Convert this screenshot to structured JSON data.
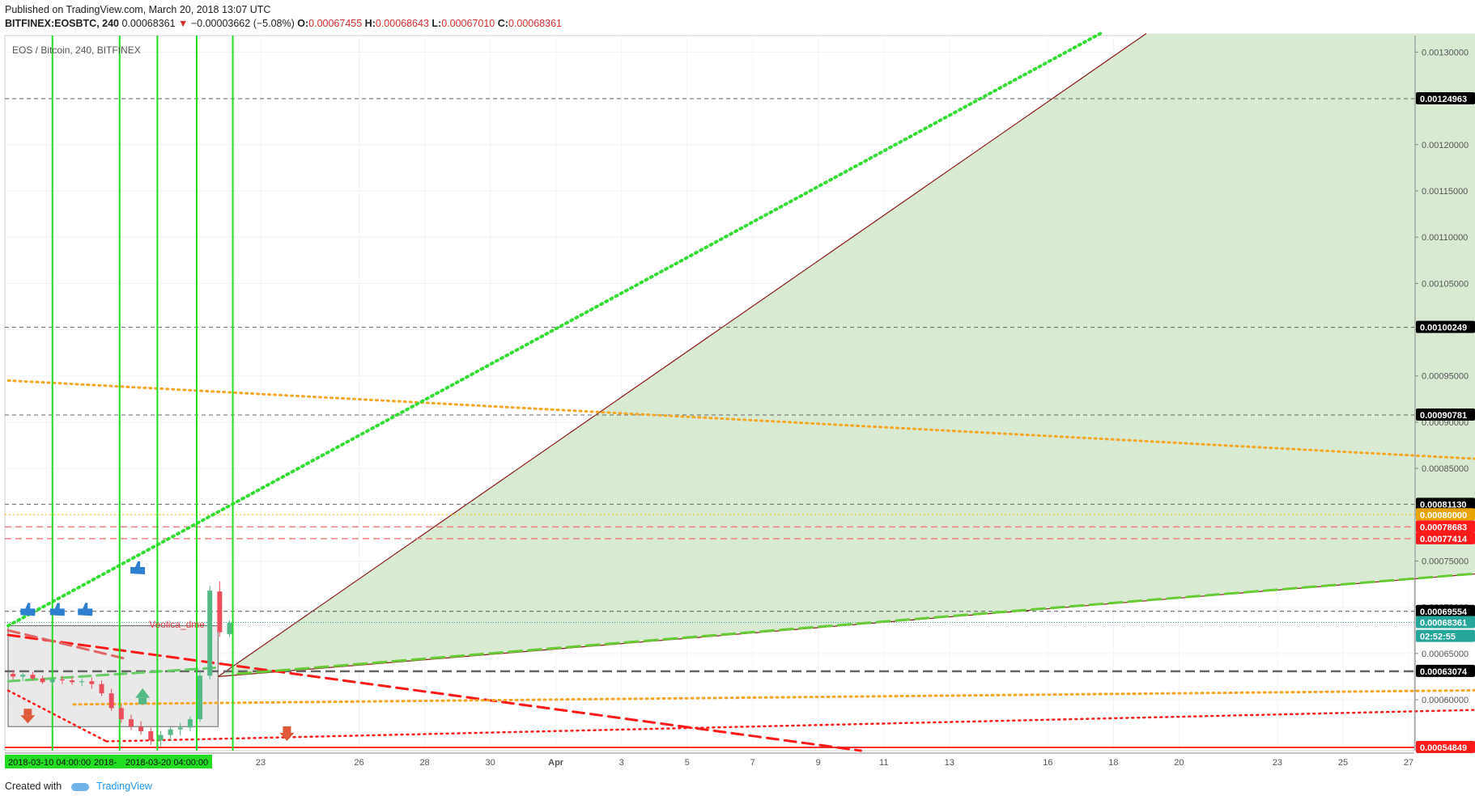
{
  "header": {
    "published": "Published on TradingView.com, March 20, 2018 13:07 UTC",
    "symbol": "BITFINEX:EOSBTC, 240",
    "last": "0.00068361",
    "change": "−0.00003662 (−5.08%)",
    "ohlc": {
      "o_label": "O:",
      "o": "0.00067455",
      "h_label": "H:",
      "h": "0.00068643",
      "l_label": "L:",
      "l": "0.00067010",
      "c_label": "C:",
      "c": "0.00068361"
    }
  },
  "footer": {
    "created_with": "Created with",
    "brand": "TradingView"
  },
  "chart_data": {
    "type": "candlestick",
    "title": "EOS / Bitcoin, 240, BITFINEX",
    "ylim": [
      0.000545,
      0.0013178
    ],
    "y_ticks": [
      "0.00130000",
      "0.00125000",
      "0.00120000",
      "0.00115000",
      "0.00110000",
      "0.00105000",
      "0.00100000",
      "0.00095000",
      "0.00090000",
      "0.00085000",
      "0.00080000",
      "0.00075000",
      "0.00070000",
      "0.00065000",
      "0.00060000",
      "0.00055000"
    ],
    "x_ticks": [
      {
        "label": "23",
        "day": 23
      },
      {
        "label": "26",
        "day": 26
      },
      {
        "label": "28",
        "day": 28
      },
      {
        "label": "30",
        "day": 30
      },
      {
        "label": "Apr",
        "day": 32
      },
      {
        "label": "3",
        "day": 34
      },
      {
        "label": "5",
        "day": 36
      },
      {
        "label": "7",
        "day": 38
      },
      {
        "label": "9",
        "day": 40
      },
      {
        "label": "11",
        "day": 42
      },
      {
        "label": "13",
        "day": 44
      },
      {
        "label": "16",
        "day": 47
      },
      {
        "label": "18",
        "day": 49
      },
      {
        "label": "20",
        "day": 51
      },
      {
        "label": "23",
        "day": 54
      },
      {
        "label": "25",
        "day": 56
      },
      {
        "label": "27",
        "day": 58
      }
    ],
    "x_axis_highlight": [
      "2018-03-10 04:00:00",
      "2018-",
      "2018-03-20 04:00:00"
    ],
    "price_labels": [
      {
        "value": "0.00124963",
        "y": 0.00124963,
        "bg": "#000000"
      },
      {
        "value": "0.00100249",
        "y": 0.00100249,
        "bg": "#000000"
      },
      {
        "value": "0.00090781",
        "y": 0.00090781,
        "bg": "#000000"
      },
      {
        "value": "0.00081130",
        "y": 0.0008113,
        "bg": "#000000"
      },
      {
        "value": "0.00080000",
        "y": 0.0008,
        "bg": "#e8a400"
      },
      {
        "value": "0.00078683",
        "y": 0.00078683,
        "bg": "#ff1a1a"
      },
      {
        "value": "0.00077414",
        "y": 0.00077414,
        "bg": "#ff1a1a"
      },
      {
        "value": "0.00069554",
        "y": 0.00069554,
        "bg": "#000000"
      },
      {
        "value": "0.00068361",
        "y": 0.00068361,
        "bg": "#26a69a"
      },
      {
        "value": "02:52:55",
        "y": 0.00066861,
        "bg": "#26a69a"
      },
      {
        "value": "0.00063074",
        "y": 0.00063074,
        "bg": "#000000"
      },
      {
        "value": "0.00054849",
        "y": 0.00054849,
        "bg": "#ff1a1a"
      }
    ],
    "horizontal_lines": [
      {
        "y": 0.00124963,
        "color": "#666666",
        "dash": "5,4",
        "width": 1
      },
      {
        "y": 0.00100249,
        "color": "#666666",
        "dash": "5,4",
        "width": 1
      },
      {
        "y": 0.00090781,
        "color": "#666666",
        "dash": "5,4",
        "width": 1
      },
      {
        "y": 0.0008113,
        "color": "#666666",
        "dash": "5,4",
        "width": 1
      },
      {
        "y": 0.0008,
        "color": "#f5c000",
        "dash": "2,3",
        "width": 1
      },
      {
        "y": 0.00078683,
        "color": "#f08080",
        "dash": "8,5",
        "width": 1.5
      },
      {
        "y": 0.00077414,
        "color": "#f08080",
        "dash": "8,5",
        "width": 1.5
      },
      {
        "y": 0.00069554,
        "color": "#555555",
        "dash": "5,4",
        "width": 1
      },
      {
        "y": 0.00068361,
        "color": "#26a69a",
        "dash": "1,2",
        "width": 1
      },
      {
        "y": 0.00063074,
        "color": "#666666",
        "dash": "12,6",
        "width": 2.5
      },
      {
        "y": 0.00054849,
        "color": "#ff3030",
        "dash": "",
        "width": 2
      }
    ],
    "trend_lines": [
      {
        "x1": 0,
        "y1": 0.00067,
        "x2": 26,
        "y2": 0.000545,
        "color": "#ff1a1a",
        "dash": "14,8",
        "width": 3
      },
      {
        "x1": 0,
        "y1": 0.000675,
        "x2": 3.5,
        "y2": 0.000645,
        "color": "#e06666",
        "dash": "14,8",
        "width": 3
      },
      {
        "x1": 0,
        "y1": 0.00062,
        "x2": 6.5,
        "y2": 0.000635,
        "color": "#66cc66",
        "dash": "14,8",
        "width": 3
      },
      {
        "x1": 2,
        "y1": 0.000595,
        "x2": 58.2,
        "y2": 0.000615,
        "color": "#f5a623",
        "dash": "2,5",
        "width": 3
      },
      {
        "x1": 0,
        "y1": 0.00061,
        "x2": 3,
        "y2": 0.000555,
        "color": "#ff1a1a",
        "dash": "2,5",
        "width": 2.5
      },
      {
        "x1": 3,
        "y1": 0.000555,
        "x2": 58.2,
        "y2": 0.0006,
        "color": "#ff1a1a",
        "dash": "2,5",
        "width": 2.5
      },
      {
        "x1": 0,
        "y1": 0.000945,
        "x2": 58.2,
        "y2": 0.000835,
        "color": "#f5a623",
        "dash": "2,5",
        "width": 3
      },
      {
        "x1": 0,
        "y1": 0.00068,
        "x2": 33.3,
        "y2": 0.00132,
        "color": "#33dd33",
        "dash": "2,5",
        "width": 4
      },
      {
        "x1": 7,
        "y1": 0.000628,
        "x2": 58.2,
        "y2": 0.000775,
        "color": "#66cc33",
        "dash": "16,8",
        "width": 3
      },
      {
        "x1": 51.5,
        "y1": 0.00132,
        "x2": 58.2,
        "y2": 0.00124963,
        "color": "#8b1a1a",
        "dash": "",
        "width": 1.2
      }
    ],
    "triangle": {
      "points": [
        [
          6.4,
          0.000625
        ],
        [
          34.7,
          0.00132
        ],
        [
          58.2,
          0.00132
        ],
        [
          58.2,
          0.000775
        ]
      ],
      "fill": "#d9ead3",
      "stroke": "#8b1a1a"
    },
    "zone_box": {
      "x1": 0,
      "x2": 6.4,
      "y1": 0.000571,
      "y2": 0.00068,
      "fill": "#e5e5e5",
      "stroke": "#666666"
    },
    "vertical_lines": [
      1.35,
      3.4,
      4.55,
      5.75,
      6.85
    ],
    "candles": [
      {
        "x": 0.15,
        "o": 0.000628,
        "h": 0.000632,
        "l": 0.000622,
        "c": 0.000625
      },
      {
        "x": 0.45,
        "o": 0.000625,
        "h": 0.000629,
        "l": 0.00062,
        "c": 0.000627
      },
      {
        "x": 0.75,
        "o": 0.000627,
        "h": 0.00063,
        "l": 0.000621,
        "c": 0.000623
      },
      {
        "x": 1.05,
        "o": 0.000623,
        "h": 0.000626,
        "l": 0.000617,
        "c": 0.000619
      },
      {
        "x": 1.35,
        "o": 0.000619,
        "h": 0.000624,
        "l": 0.000614,
        "c": 0.000622
      },
      {
        "x": 1.65,
        "o": 0.000622,
        "h": 0.000626,
        "l": 0.000617,
        "c": 0.000621
      },
      {
        "x": 1.95,
        "o": 0.000621,
        "h": 0.000625,
        "l": 0.000616,
        "c": 0.000619
      },
      {
        "x": 2.25,
        "o": 0.000619,
        "h": 0.000623,
        "l": 0.000615,
        "c": 0.00062
      },
      {
        "x": 2.55,
        "o": 0.00062,
        "h": 0.000624,
        "l": 0.000612,
        "c": 0.000617
      },
      {
        "x": 2.85,
        "o": 0.000617,
        "h": 0.000621,
        "l": 0.000604,
        "c": 0.000607
      },
      {
        "x": 3.15,
        "o": 0.000607,
        "h": 0.000612,
        "l": 0.000588,
        "c": 0.000591
      },
      {
        "x": 3.45,
        "o": 0.000591,
        "h": 0.000595,
        "l": 0.000575,
        "c": 0.000579
      },
      {
        "x": 3.75,
        "o": 0.000579,
        "h": 0.000584,
        "l": 0.000567,
        "c": 0.000571
      },
      {
        "x": 4.05,
        "o": 0.000571,
        "h": 0.000577,
        "l": 0.000562,
        "c": 0.000566
      },
      {
        "x": 4.35,
        "o": 0.000566,
        "h": 0.00057,
        "l": 0.000551,
        "c": 0.000556
      },
      {
        "x": 4.65,
        "o": 0.000556,
        "h": 0.000566,
        "l": 0.00055,
        "c": 0.000562
      },
      {
        "x": 4.95,
        "o": 0.000562,
        "h": 0.000571,
        "l": 0.000556,
        "c": 0.000568
      },
      {
        "x": 5.25,
        "o": 0.000568,
        "h": 0.000575,
        "l": 0.000561,
        "c": 0.00057
      },
      {
        "x": 5.55,
        "o": 0.00057,
        "h": 0.000582,
        "l": 0.000566,
        "c": 0.000579
      },
      {
        "x": 5.85,
        "o": 0.000579,
        "h": 0.000631,
        "l": 0.000576,
        "c": 0.000626
      },
      {
        "x": 6.15,
        "o": 0.000626,
        "h": 0.000723,
        "l": 0.000622,
        "c": 0.000718
      },
      {
        "x": 6.45,
        "o": 0.000717,
        "h": 0.000728,
        "l": 0.000668,
        "c": 0.000673
      },
      {
        "x": 6.75,
        "o": 0.000671,
        "h": 0.000686,
        "l": 0.000668,
        "c": 0.000683
      }
    ],
    "annotation_text": "Veolica_dme",
    "up_color": "#53b987",
    "down_color": "#eb4d5c"
  }
}
